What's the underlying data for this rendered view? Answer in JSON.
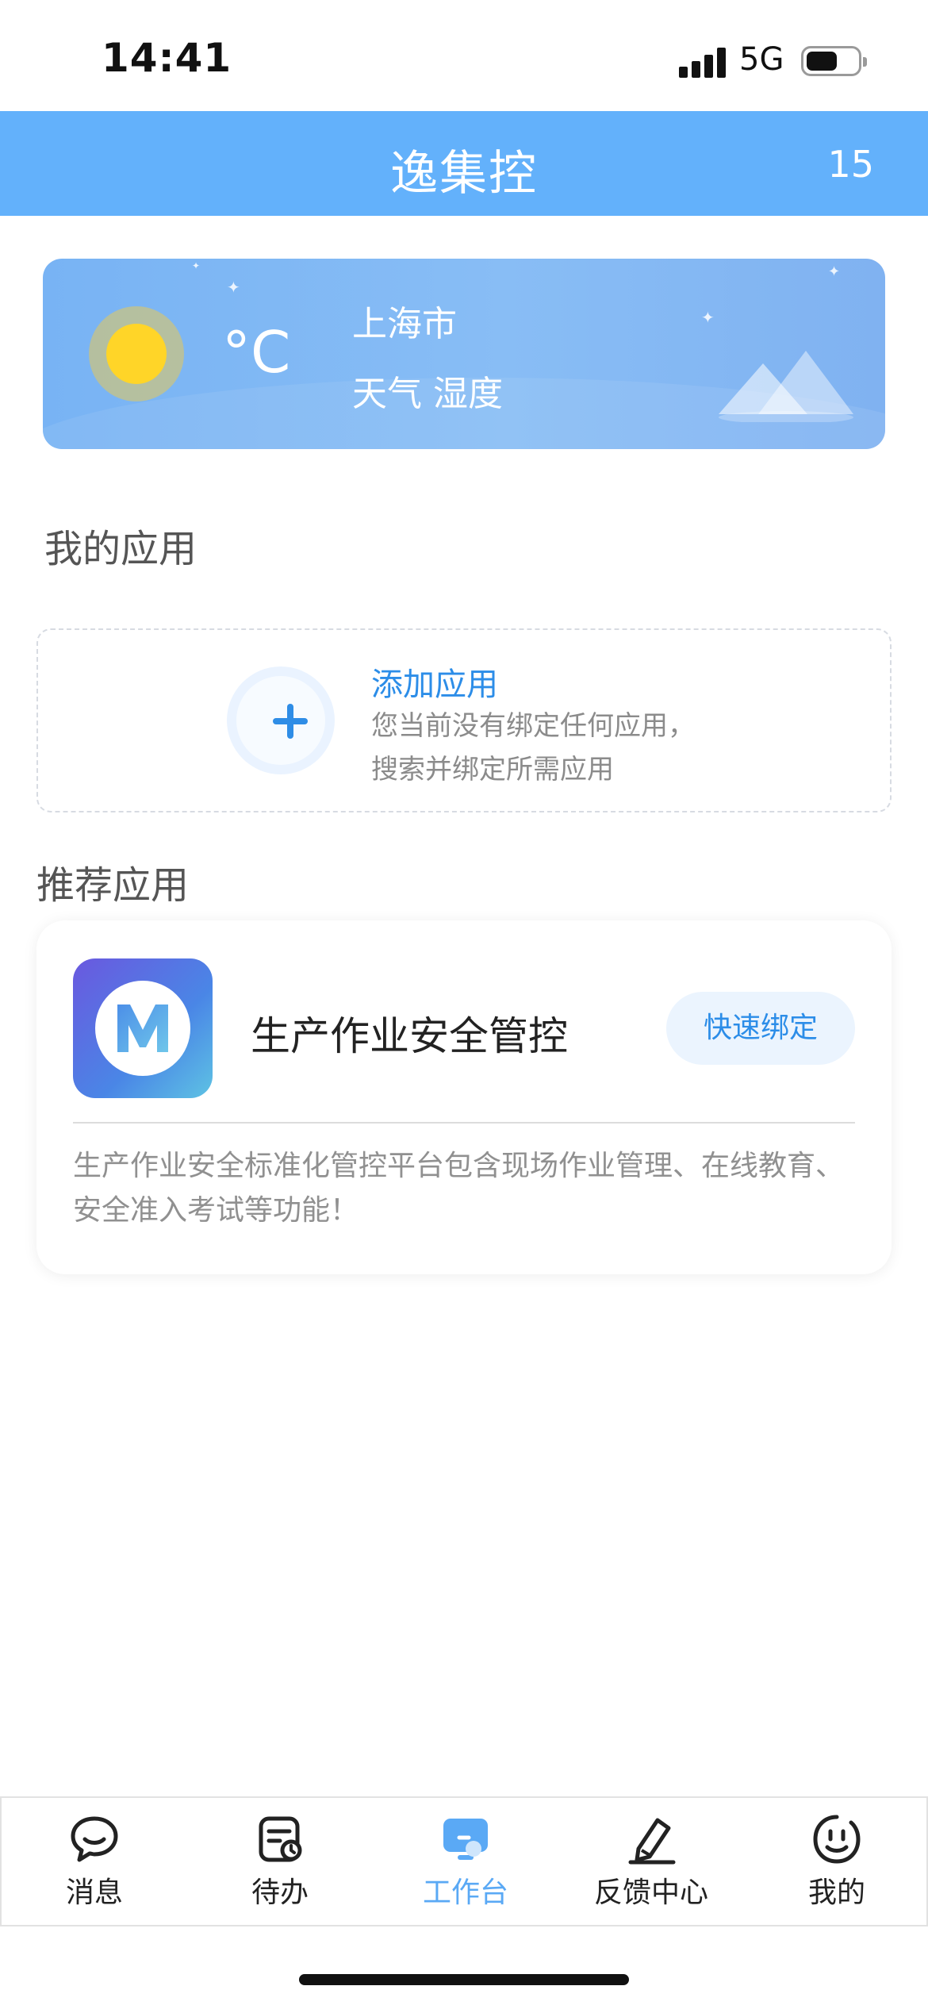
{
  "status_bar": {
    "time": "14:41",
    "network": "5G"
  },
  "header": {
    "title": "逸集控",
    "count": "15"
  },
  "weather": {
    "temperature_unit": "°C",
    "city": "上海市",
    "description": "天气 湿度"
  },
  "my_apps": {
    "title": "我的应用",
    "add_title": "添加应用",
    "add_description": "您当前没有绑定任何应用，搜索并绑定所需应用"
  },
  "recommended": {
    "title": "推荐应用",
    "app_name": "生产作业安全管控",
    "icon_letter": "M",
    "bind_label": "快速绑定",
    "description": "生产作业安全标准化管控平台包含现场作业管理、在线教育、安全准入考试等功能！"
  },
  "tabs": [
    {
      "label": "消息",
      "icon": "chat-bubble-icon"
    },
    {
      "label": "待办",
      "icon": "todo-clipboard-icon"
    },
    {
      "label": "工作台",
      "icon": "workbench-icon",
      "active": true
    },
    {
      "label": "反馈中心",
      "icon": "pen-feedback-icon"
    },
    {
      "label": "我的",
      "icon": "smiley-profile-icon"
    }
  ],
  "colors": {
    "header": "#63b1fb",
    "accent": "#2c8de8",
    "active_tab": "#5aa9f5"
  }
}
